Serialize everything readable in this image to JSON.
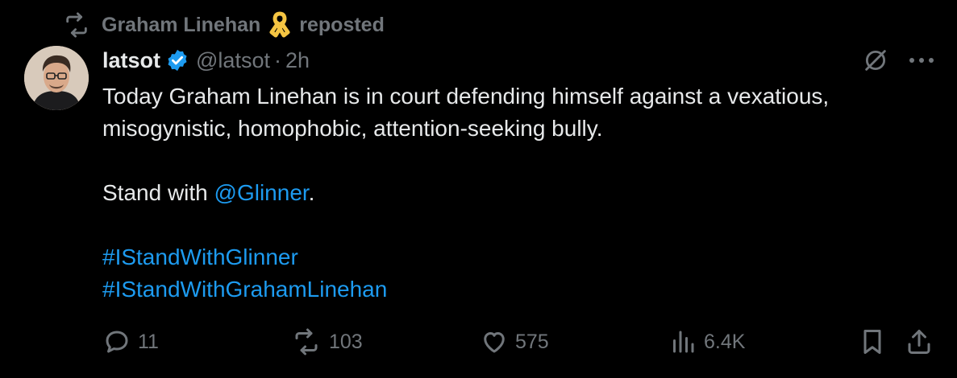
{
  "repost": {
    "user": "Graham Linehan",
    "label": "reposted"
  },
  "author": {
    "name": "latsot",
    "handle": "@latsot",
    "separator": "·",
    "time": "2h"
  },
  "body": {
    "line1": "Today Graham Linehan is in court defending himself against a vexatious,",
    "line2": "misogynistic, homophobic, attention-seeking bully.",
    "stand_prefix": "Stand with ",
    "mention": "@Glinner",
    "stand_suffix": ".",
    "hashtags": [
      "#IStandWithGlinner",
      "#IStandWithGrahamLinehan"
    ]
  },
  "actions": {
    "replies": "11",
    "reposts": "103",
    "likes": "575",
    "views": "6.4K"
  },
  "colors": {
    "background": "#000000",
    "text": "#e7e9ea",
    "muted": "#71767b",
    "link": "#1d9bf0",
    "verified": "#1d9bf0",
    "ribbon": "#f5c542"
  },
  "icons": {
    "repost": "repost-icon",
    "ribbon": "awareness-ribbon-icon",
    "verified": "verified-badge-icon",
    "grok": "grok-icon",
    "more": "more-icon",
    "reply": "reply-icon",
    "retweet": "retweet-icon",
    "like": "heart-icon",
    "views": "views-icon",
    "bookmark": "bookmark-icon",
    "share": "share-icon"
  }
}
